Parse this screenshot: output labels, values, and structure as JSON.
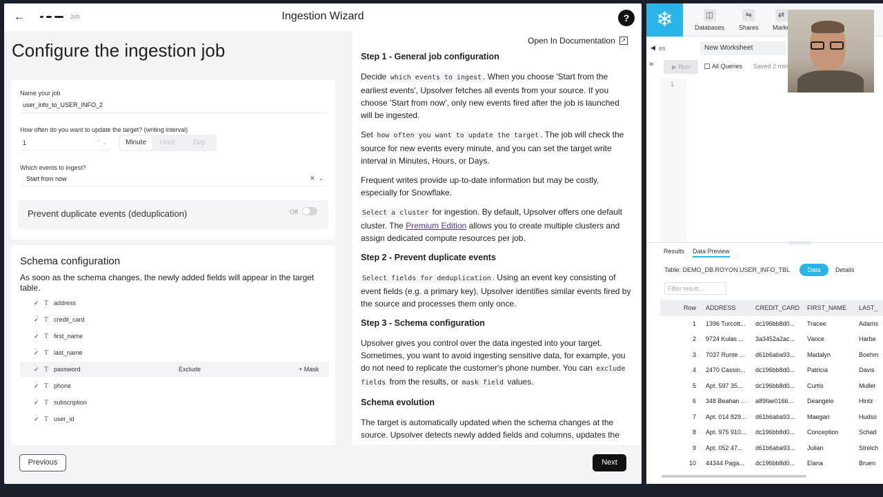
{
  "wizard": {
    "title": "Ingestion Wizard",
    "breadcrumb": "Job",
    "help": "?",
    "page_title": "Configure the ingestion job"
  },
  "form": {
    "job_name_label": "Name your job",
    "job_name_value": "user_info_to_USER_INFO_2",
    "interval_label": "How often do you want to update the target? (writing interval)",
    "interval_value": "1",
    "interval_units": [
      "Minute",
      "Hour",
      "Day"
    ],
    "interval_selected": "Minute",
    "events_label": "Which events to ingest?",
    "events_value": "Start from now",
    "dedup_label": "Prevent duplicate events (deduplication)",
    "dedup_state": "Off"
  },
  "schema": {
    "title": "Schema configuration",
    "description": "As soon as the schema changes, the newly added fields will appear in the target table.",
    "fields": [
      "address",
      "credit_card",
      "first_name",
      "last_name",
      "password",
      "phone",
      "subscription",
      "user_id"
    ],
    "row_actions": {
      "exclude": "Exclude",
      "mask": "+ Mask"
    }
  },
  "footer": {
    "previous": "Previous",
    "next": "Next"
  },
  "docs": {
    "open_link": "Open In Documentation",
    "step1_title": "Step 1 - General job configuration",
    "step1_p1_pre": "Decide ",
    "step1_p1_code": "which events to ingest",
    "step1_p1_post": ". When you choose 'Start from the earliest events', Upsolver fetches all events from your source. If you choose 'Start from now', only new events fired after the job is launched will be ingested.",
    "step1_p2_pre": "Set ",
    "step1_p2_code": "how often you want to update the target",
    "step1_p2_post": ". The job will check the source for new events every minute, and you can set the target write interval in Minutes, Hours, or Days.",
    "step1_p3": "Frequent writes provide up-to-date information but may be costly, especially for Snowflake.",
    "step1_p4_code": "Select a cluster",
    "step1_p4_mid": " for ingestion. By default, Upsolver offers one default cluster. The ",
    "step1_p4_link": "Premium Edition",
    "step1_p4_post": " allows you to create multiple clusters and assign dedicated compute resources per job.",
    "step2_title": "Step 2 - Prevent duplicate events",
    "step2_p1_code": "Select fields for deduplication",
    "step2_p1_post": ". Using an event key consisting of event fields (e.g. a primary key), Upsolver identifies similar events fired by the source and processes them only once.",
    "step3_title": "Step 3 - Schema configuration",
    "step3_p1_pre": "Upsolver gives you control over the data ingested into your target. Sometimes, you want to avoid ingesting sensitive data, for example, you do not need to replicate the customer's phone number. You can ",
    "step3_p1_code1": "exclude fields",
    "step3_p1_mid": " from the results, or ",
    "step3_p1_code2": "mask field",
    "step3_p1_post": " values.",
    "evo_title": "Schema evolution",
    "evo_p1": "The target is automatically updated when the schema changes at the source. Upsolver detects newly added fields and columns, updates the"
  },
  "snowflake": {
    "nav": [
      {
        "label": "Databases",
        "icon": "database-icon"
      },
      {
        "label": "Shares",
        "icon": "shares-icon"
      },
      {
        "label": "Marke",
        "icon": "marketplace-icon"
      }
    ],
    "prev_tab": "es",
    "worksheet_tab": "New Worksheet",
    "run": "Run",
    "all_queries": "All Queries",
    "saved": "Saved 2 min",
    "line_number": "1",
    "result_tabs": [
      "Results",
      "Data Preview"
    ],
    "table_label": "Table: DEMO_DB.ROYON.USER_INFO_TBL",
    "data_btn": "Data",
    "details_btn": "Details",
    "filter_placeholder": "Filter result...",
    "columns": [
      "Row",
      "ADDRESS",
      "CREDIT_CARD",
      "FIRST_NAME",
      "LAST_"
    ],
    "rows": [
      [
        "1",
        "1396 Turcott...",
        "dc196bb8d0...",
        "Tracee",
        "Adams"
      ],
      [
        "2",
        "9724 Kulas ...",
        "3a3452a2ac...",
        "Vance",
        "Harbe"
      ],
      [
        "3",
        "7037 Runte ...",
        "d61b6aba93...",
        "Madalyn",
        "Boehm"
      ],
      [
        "4",
        "2470 Cassin...",
        "dc196bb8d0...",
        "Patricia",
        "Davis"
      ],
      [
        "5",
        "Apt. 597 35...",
        "dc196bb8d0...",
        "Curtis",
        "Muller"
      ],
      [
        "6",
        "348 Beahan ...",
        "a89fae0166...",
        "Deangelo",
        "Hintz"
      ],
      [
        "7",
        "Apt. 014 829...",
        "d61b6aba93...",
        "Maegan",
        "Hudso"
      ],
      [
        "8",
        "Apt. 975 910...",
        "dc196bb8d0...",
        "Conception",
        "Schad"
      ],
      [
        "9",
        "Apt. 052 47...",
        "d61b6aba93...",
        "Julian",
        "Streich"
      ],
      [
        "10",
        "44344 Paga...",
        "dc196bb8d0...",
        "Elana",
        "Bruen"
      ]
    ]
  }
}
